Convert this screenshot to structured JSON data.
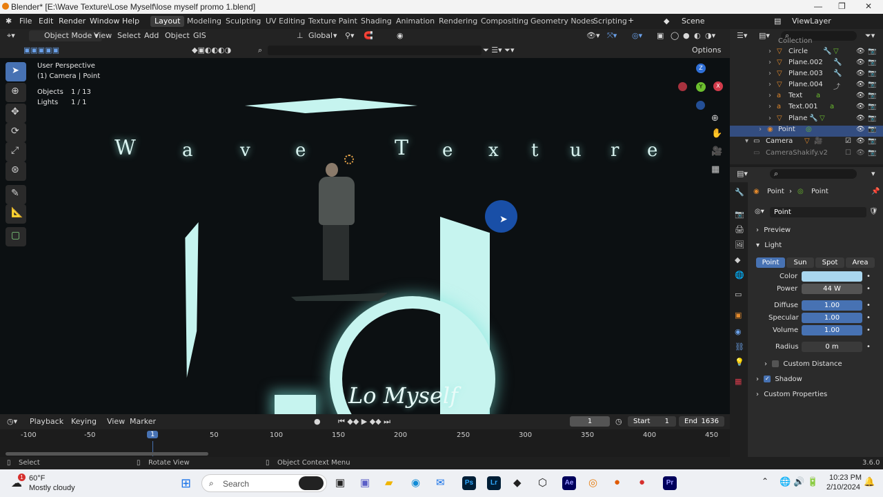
{
  "window": {
    "title": "Blender* [E:\\Wave Texture\\Lose Myself\\lose myself promo 1.blend]"
  },
  "menus": [
    "File",
    "Edit",
    "Render",
    "Window",
    "Help"
  ],
  "workspaces": [
    "Layout",
    "Modeling",
    "Sculpting",
    "UV Editing",
    "Texture Paint",
    "Shading",
    "Animation",
    "Rendering",
    "Compositing",
    "Geometry Nodes",
    "Scripting"
  ],
  "scene": "Scene",
  "view_layer": "ViewLayer",
  "header": {
    "mode": "Object Mode",
    "menus": [
      "View",
      "Select",
      "Add",
      "Object",
      "GIS"
    ],
    "orientation": "Global",
    "options": "Options"
  },
  "viewport": {
    "perspective": "User Perspective",
    "active": "(1) Camera | Point",
    "objects_label": "Objects",
    "objects_value": "1 / 13",
    "lights_label": "Lights",
    "lights_value": "1 / 1",
    "wave_text": [
      "W",
      "a",
      "v",
      "e",
      "T",
      "e",
      "x",
      "t",
      "u",
      "r",
      "e"
    ],
    "logo_text": "Lo  Myself"
  },
  "timeline": {
    "playback": "Playback",
    "keying": "Keying",
    "view": "View",
    "marker": "Marker",
    "current_frame": "1",
    "start_label": "Start",
    "start": "1",
    "end_label": "End",
    "end": "1636",
    "ticks": [
      "-100",
      "-50",
      "1",
      "50",
      "100",
      "150",
      "200",
      "250",
      "300",
      "350",
      "400",
      "450"
    ]
  },
  "status": {
    "select": "Select",
    "rotate": "Rotate View",
    "context": "Object Context Menu",
    "version": "3.6.0"
  },
  "outliner": {
    "collection": "Collection",
    "rows": [
      {
        "name": "Circle",
        "selected": false
      },
      {
        "name": "Plane.002",
        "selected": false
      },
      {
        "name": "Plane.003",
        "selected": false
      },
      {
        "name": "Plane.004",
        "selected": false
      },
      {
        "name": "Text",
        "selected": false
      },
      {
        "name": "Text.001",
        "selected": false
      },
      {
        "name": "Plane",
        "selected": false
      },
      {
        "name": "Point",
        "selected": true
      },
      {
        "name": "Camera",
        "selected": false
      },
      {
        "name": "CameraShakify.v2",
        "selected": false
      }
    ]
  },
  "properties": {
    "breadcrumb_1": "Point",
    "breadcrumb_2": "Point",
    "datablock": "Point",
    "preview": "Preview",
    "light": "Light",
    "light_types": [
      "Point",
      "Sun",
      "Spot",
      "Area"
    ],
    "color_label": "Color",
    "color": "#a9d6ee",
    "power_label": "Power",
    "power": "44 W",
    "diffuse_label": "Diffuse",
    "diffuse": "1.00",
    "specular_label": "Specular",
    "specular": "1.00",
    "volume_label": "Volume",
    "volume": "1.00",
    "radius_label": "Radius",
    "radius": "0 m",
    "custom_distance": "Custom Distance",
    "shadow": "Shadow",
    "custom_properties": "Custom Properties"
  },
  "taskbar": {
    "temp": "60°F",
    "weather": "Mostly cloudy",
    "search": "Search",
    "time": "10:23 PM",
    "date": "2/10/2024",
    "apps": [
      "Ps",
      "Lr",
      "Ae",
      "Pr"
    ]
  }
}
